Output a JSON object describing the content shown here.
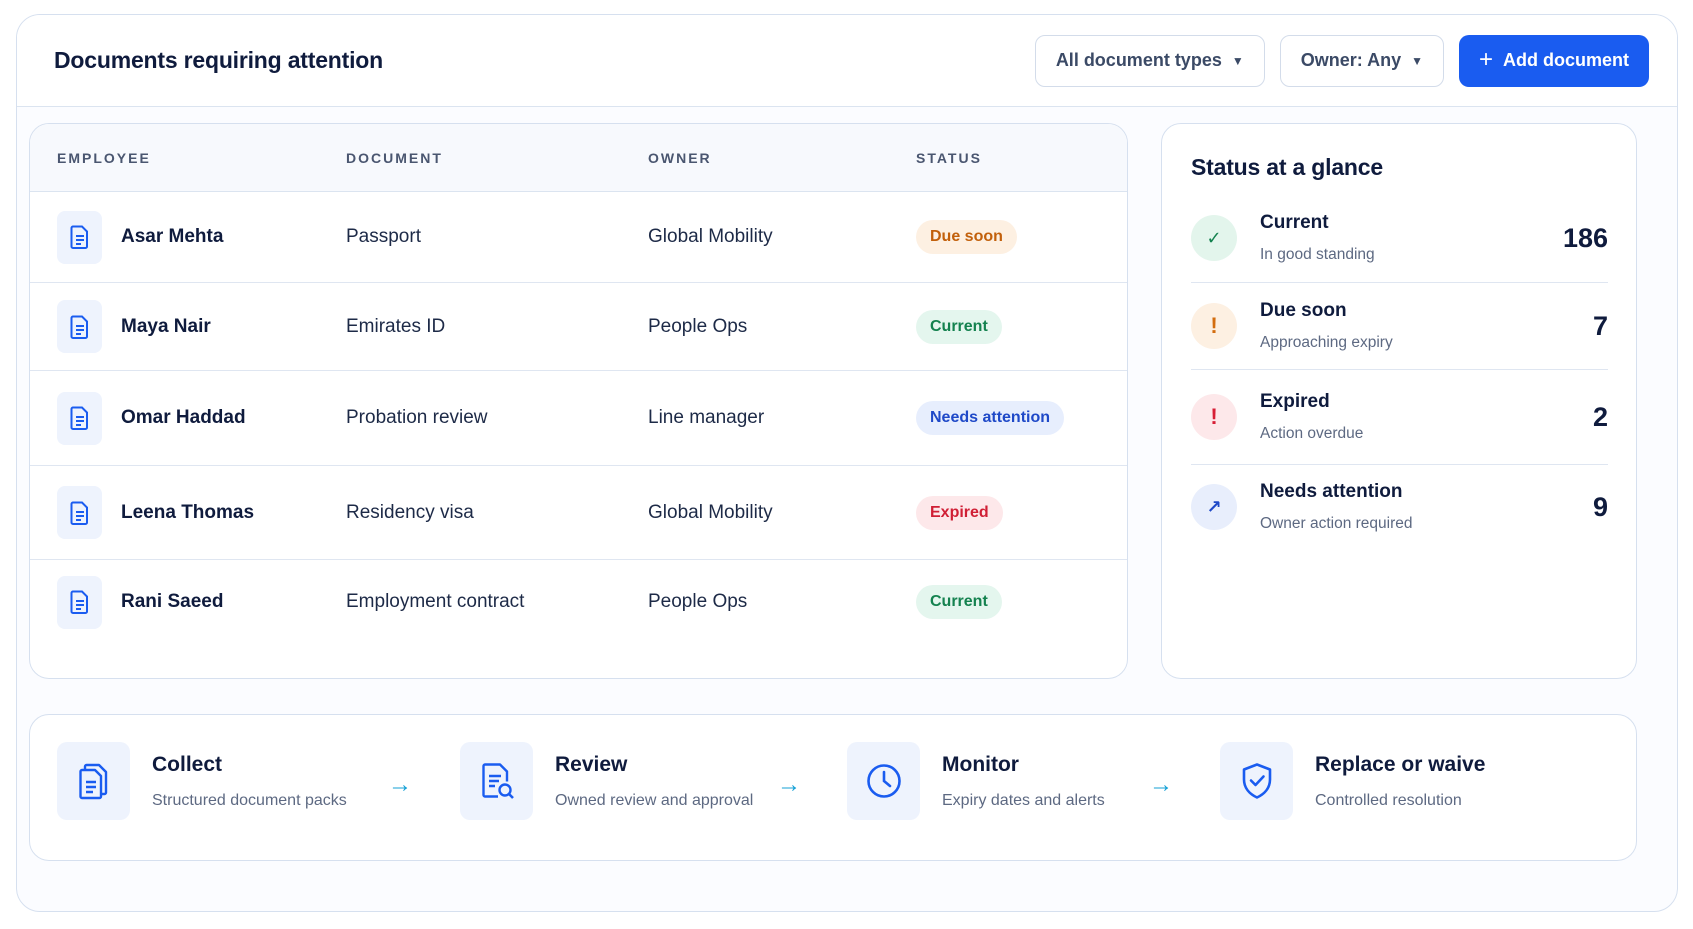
{
  "header": {
    "title": "Documents requiring attention",
    "filter_type": "All document types",
    "filter_owner": "Owner: Any",
    "add_label": "Add document"
  },
  "table": {
    "columns": [
      "EMPLOYEE",
      "DOCUMENT",
      "OWNER",
      "STATUS"
    ],
    "rows": [
      {
        "employee": "Asar Mehta",
        "document": "Passport",
        "owner": "Global Mobility",
        "status": "Due soon",
        "kind": "due"
      },
      {
        "employee": "Maya Nair",
        "document": "Emirates ID",
        "owner": "People Ops",
        "status": "Current",
        "kind": "current"
      },
      {
        "employee": "Omar Haddad",
        "document": "Probation review",
        "owner": "Line manager",
        "status": "Needs attention",
        "kind": "attention"
      },
      {
        "employee": "Leena Thomas",
        "document": "Residency visa",
        "owner": "Global Mobility",
        "status": "Expired",
        "kind": "expired"
      },
      {
        "employee": "Rani Saeed",
        "document": "Employment contract",
        "owner": "People Ops",
        "status": "Current",
        "kind": "current"
      }
    ]
  },
  "summary": {
    "title": "Status at a glance",
    "items": [
      {
        "label": "Current",
        "sub": "In good standing",
        "value": "186",
        "icon": "check-icon",
        "glyph": "✓"
      },
      {
        "label": "Due soon",
        "sub": "Approaching expiry",
        "value": "7",
        "icon": "exclamation-icon",
        "glyph": "!"
      },
      {
        "label": "Expired",
        "sub": "Action overdue",
        "value": "2",
        "icon": "exclamation-icon",
        "glyph": "!"
      },
      {
        "label": "Needs attention",
        "sub": "Owner action required",
        "value": "9",
        "icon": "arrow-up-right-icon",
        "glyph": "↗"
      }
    ]
  },
  "flow": {
    "steps": [
      {
        "title": "Collect",
        "sub": "Structured document packs",
        "icon": "document-stack-icon"
      },
      {
        "title": "Review",
        "sub": "Owned review and approval",
        "icon": "document-search-icon"
      },
      {
        "title": "Monitor",
        "sub": "Expiry dates and alerts",
        "icon": "clock-icon"
      },
      {
        "title": "Replace or waive",
        "sub": "Controlled resolution",
        "icon": "shield-check-icon"
      }
    ],
    "arrow_glyph": "→"
  },
  "colors": {
    "primary": "#1a5cf0",
    "due_soon": "#c2600b",
    "current": "#14824f",
    "needs_attention": "#1f49c8",
    "expired": "#d01f35",
    "flow_arrow": "#14a0d6"
  }
}
